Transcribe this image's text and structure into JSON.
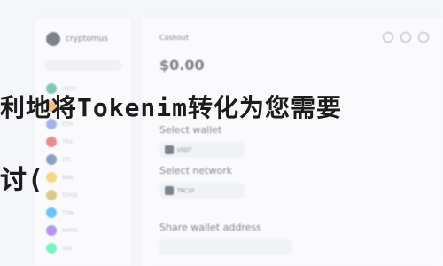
{
  "sidebar": {
    "brand_name": "cryptomus",
    "coins": [
      "USDT",
      "BTC",
      "ETH",
      "TRX",
      "LTC",
      "BNB",
      "DOGE",
      "TON",
      "MATIC",
      "SOL"
    ]
  },
  "main": {
    "title": "Cashout",
    "balance": "$0.00",
    "select_wallet_label": "Select wallet",
    "select_network_label": "Select network",
    "share_wallet_label": "Share wallet address",
    "wallet_value": "USDT",
    "network_value": "TRC20",
    "address_value": ""
  },
  "overlay": {
    "line1": "利地将Tokenim转化为您需要",
    "line2": "讨("
  }
}
